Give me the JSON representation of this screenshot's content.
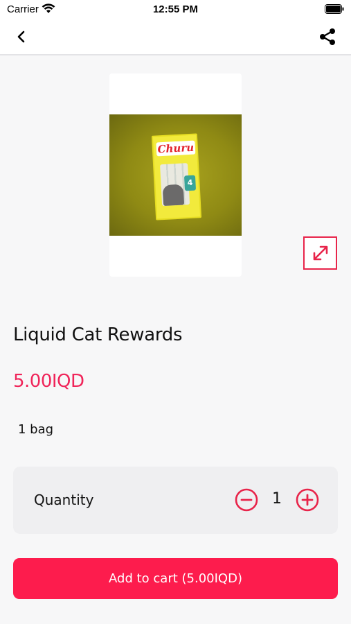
{
  "status_bar": {
    "carrier": "Carrier",
    "time": "12:55 PM"
  },
  "nav": {
    "back_icon": "chevron-left-icon",
    "share_icon": "share-icon"
  },
  "product": {
    "image_alt_brand": "Churu",
    "image_badge": "4",
    "name": "Liquid Cat Rewards",
    "price": "5.00IQD",
    "unit": "1 bag",
    "expand_icon": "expand-icon"
  },
  "quantity": {
    "label": "Quantity",
    "value": "1",
    "minus_icon": "minus-circle-icon",
    "plus_icon": "plus-circle-icon"
  },
  "cart": {
    "button_label": "Add to cart (5.00IQD)"
  },
  "colors": {
    "accent": "#fd1c4d",
    "price": "#f0255a",
    "background": "#f7f7f8",
    "card": "#efeff1"
  }
}
